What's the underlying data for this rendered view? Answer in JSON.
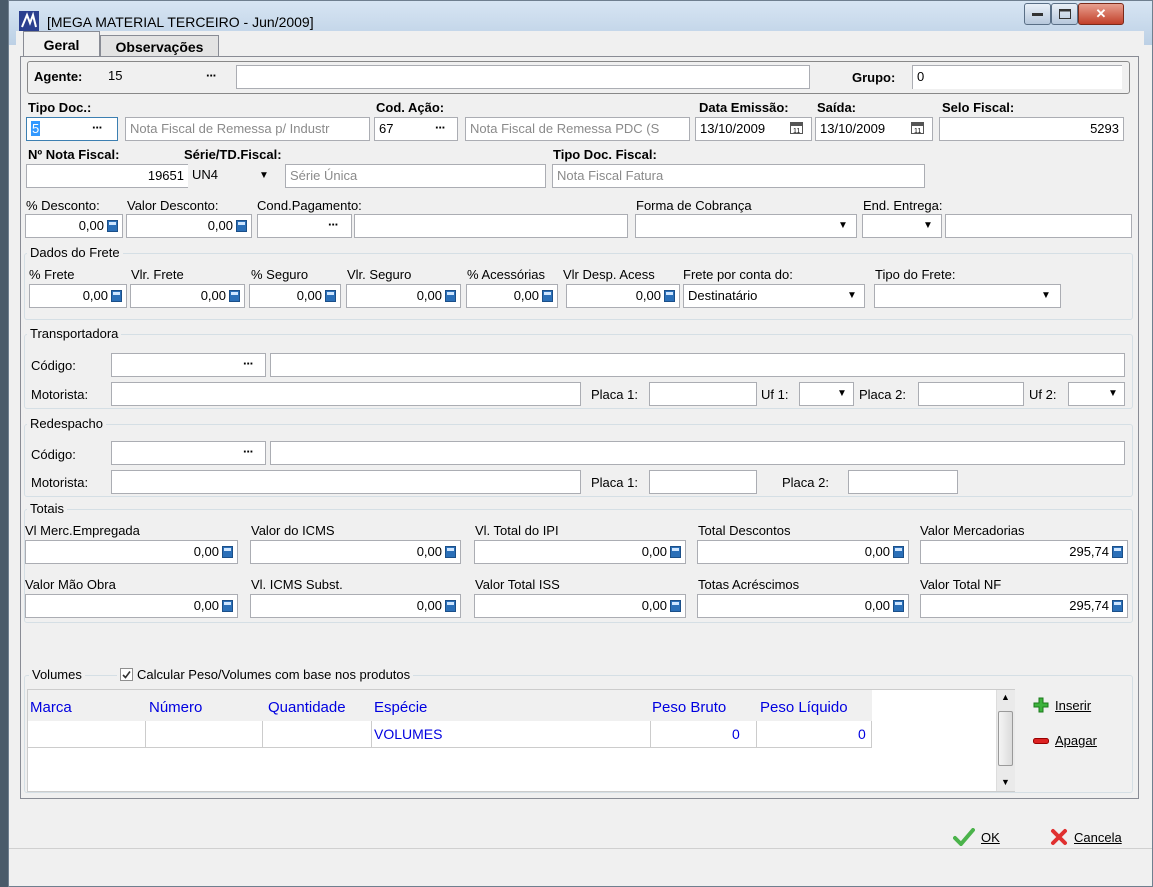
{
  "window": {
    "title": "[MEGA MATERIAL TERCEIRO - Jun/2009]"
  },
  "tabs": [
    {
      "label": "Geral"
    },
    {
      "label": "Observações"
    }
  ],
  "agente": {
    "label": "Agente:",
    "code": "15",
    "name": ""
  },
  "grupo": {
    "label": "Grupo:",
    "value": "0"
  },
  "tipo_doc": {
    "label": "Tipo Doc.:",
    "code": "5",
    "desc": "Nota Fiscal de Remessa p/ Industr"
  },
  "cod_acao": {
    "label": "Cod. Ação:",
    "code": "67",
    "desc": "Nota Fiscal de Remessa PDC (S"
  },
  "data_emissao": {
    "label": "Data Emissão:",
    "value": "13/10/2009"
  },
  "saida": {
    "label": "Saída:",
    "value": "13/10/2009"
  },
  "selo_fiscal": {
    "label": "Selo Fiscal:",
    "value": "5293"
  },
  "nota_fiscal": {
    "label": "Nº Nota Fiscal:",
    "value": "19651"
  },
  "serie": {
    "label": "Série/TD.Fiscal:",
    "code": "UN4",
    "desc": "Série Única"
  },
  "tipo_doc_fiscal": {
    "label": "Tipo Doc. Fiscal:",
    "desc": "Nota Fiscal Fatura"
  },
  "desconto": {
    "pct_label": "% Desconto:",
    "pct_value": "0,00",
    "val_label": "Valor Desconto:",
    "val_value": "0,00"
  },
  "cond_pagamento": {
    "label": "Cond.Pagamento:",
    "value": ""
  },
  "forma_cobranca": {
    "label": "Forma de Cobrança",
    "value": ""
  },
  "end_entrega": {
    "label": "End. Entrega:",
    "value": ""
  },
  "frete": {
    "title": "Dados do Frete",
    "pct_frete_label": "% Frete",
    "pct_frete": "0,00",
    "vlr_frete_label": "Vlr. Frete",
    "vlr_frete": "0,00",
    "pct_seguro_label": "% Seguro",
    "pct_seguro": "0,00",
    "vlr_seguro_label": "Vlr. Seguro",
    "vlr_seguro": "0,00",
    "pct_acess_label": "% Acessórias",
    "pct_acess": "0,00",
    "vlr_acess_label": "Vlr Desp. Acess",
    "vlr_acess": "0,00",
    "conta_label": "Frete por conta do:",
    "conta_value": "Destinatário",
    "tipo_label": "Tipo do Frete:",
    "tipo_value": ""
  },
  "transportadora": {
    "title": "Transportadora",
    "codigo_label": "Código:",
    "motorista_label": "Motorista:",
    "placa1_label": "Placa 1:",
    "uf1_label": "Uf 1:",
    "placa2_label": "Placa 2:",
    "uf2_label": "Uf 2:"
  },
  "redespacho": {
    "title": "Redespacho",
    "codigo_label": "Código:",
    "motorista_label": "Motorista:",
    "placa1_label": "Placa 1:",
    "placa2_label": "Placa 2:"
  },
  "totais": {
    "title": "Totais",
    "vl_merc_label": "Vl Merc.Empregada",
    "vl_merc": "0,00",
    "icms_label": "Valor do ICMS",
    "icms": "0,00",
    "ipi_label": "Vl. Total do IPI",
    "ipi": "0,00",
    "desc_label": "Total Descontos",
    "desc": "0,00",
    "merc_label": "Valor Mercadorias",
    "merc": "295,74",
    "mao_obra_label": "Valor Mão Obra",
    "mao_obra": "0,00",
    "icms_subst_label": "Vl. ICMS Subst.",
    "icms_subst": "0,00",
    "iss_label": "Valor Total ISS",
    "iss": "0,00",
    "acresc_label": "Totas Acréscimos",
    "acresc": "0,00",
    "total_nf_label": "Valor Total NF",
    "total_nf": "295,74"
  },
  "volumes": {
    "title": "Volumes",
    "checkbox_label": "Calcular Peso/Volumes com base nos produtos",
    "checked": true,
    "columns": [
      "Marca",
      "Número",
      "Quantidade",
      "Espécie",
      "Peso Bruto",
      "Peso Líquido"
    ],
    "rows": [
      {
        "marca": "",
        "numero": "",
        "quantidade": "",
        "especie": "VOLUMES",
        "peso_bruto": "0",
        "peso_liquido": "0"
      }
    ],
    "inserir": "Inserir",
    "apagar": "Apagar"
  },
  "footer": {
    "ok": "OK",
    "cancela": "Cancela"
  },
  "colors": {
    "accent_blue": "#0000e0",
    "title_grad_top": "#d7e5f3",
    "close_red": "#c2402a"
  }
}
